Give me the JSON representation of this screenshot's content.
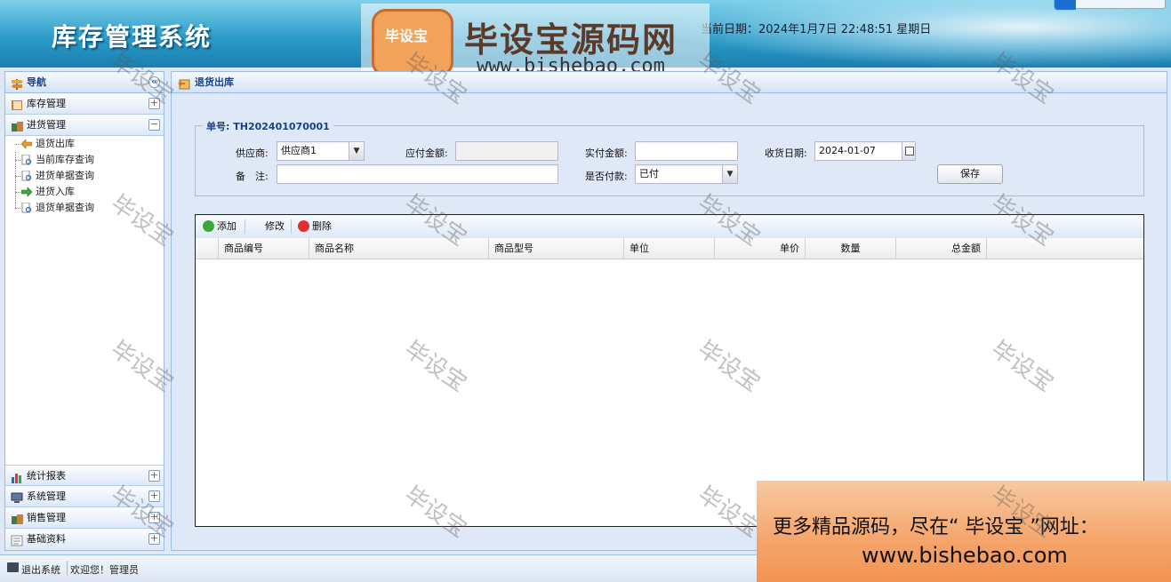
{
  "header": {
    "app_title": "库存管理系统",
    "date_label": "当前日期：2024年1月7日 22:48:51 星期日"
  },
  "watermark": {
    "badge": "毕设宝",
    "brand": "毕设宝源码网",
    "url": "www.bishebao.com",
    "tile": "毕设宝"
  },
  "sidebar": {
    "title": "导航",
    "collapse_glyph": "«",
    "sections": [
      {
        "label": "库存管理",
        "toggle": "+"
      },
      {
        "label": "进货管理",
        "toggle": "−"
      }
    ],
    "tree_items": [
      {
        "label": "退货出库"
      },
      {
        "label": "当前库存查询"
      },
      {
        "label": "进货单据查询"
      },
      {
        "label": "进货入库"
      },
      {
        "label": "退货单据查询"
      }
    ],
    "bottom_sections": [
      {
        "label": "统计报表",
        "toggle": "+"
      },
      {
        "label": "系统管理",
        "toggle": "+"
      },
      {
        "label": "销售管理",
        "toggle": "+"
      },
      {
        "label": "基础资料",
        "toggle": "+"
      }
    ]
  },
  "main": {
    "title": "退货出库",
    "form": {
      "order_no_label": "单号:",
      "order_no": "TH202401070001",
      "supplier_label": "供应商:",
      "supplier_value": "供应商1",
      "payable_label": "应付金额:",
      "payable_value": "",
      "actual_label": "实付金额:",
      "actual_value": "",
      "receive_date_label": "收货日期:",
      "receive_date_value": "2024-01-07",
      "remark_label": "备　注:",
      "remark_value": "",
      "paid_label": "是否付款:",
      "paid_value": "已付",
      "save_label": "保存"
    },
    "toolbar": {
      "add": "添加",
      "edit": "修改",
      "delete": "删除"
    },
    "columns": [
      "商品编号",
      "商品名称",
      "商品型号",
      "单位",
      "单价",
      "数量",
      "总金额"
    ]
  },
  "status": {
    "logout": "退出系统",
    "welcome": "欢迎您！管理员"
  },
  "ad": {
    "line1": "更多精品源码，尽在“ 毕设宝 ”网址：",
    "line2": "www.bishebao.com"
  },
  "colors": {
    "accent": "#15428b",
    "panel_border": "#99bbe8",
    "header_blue": "#2c9cc9"
  }
}
